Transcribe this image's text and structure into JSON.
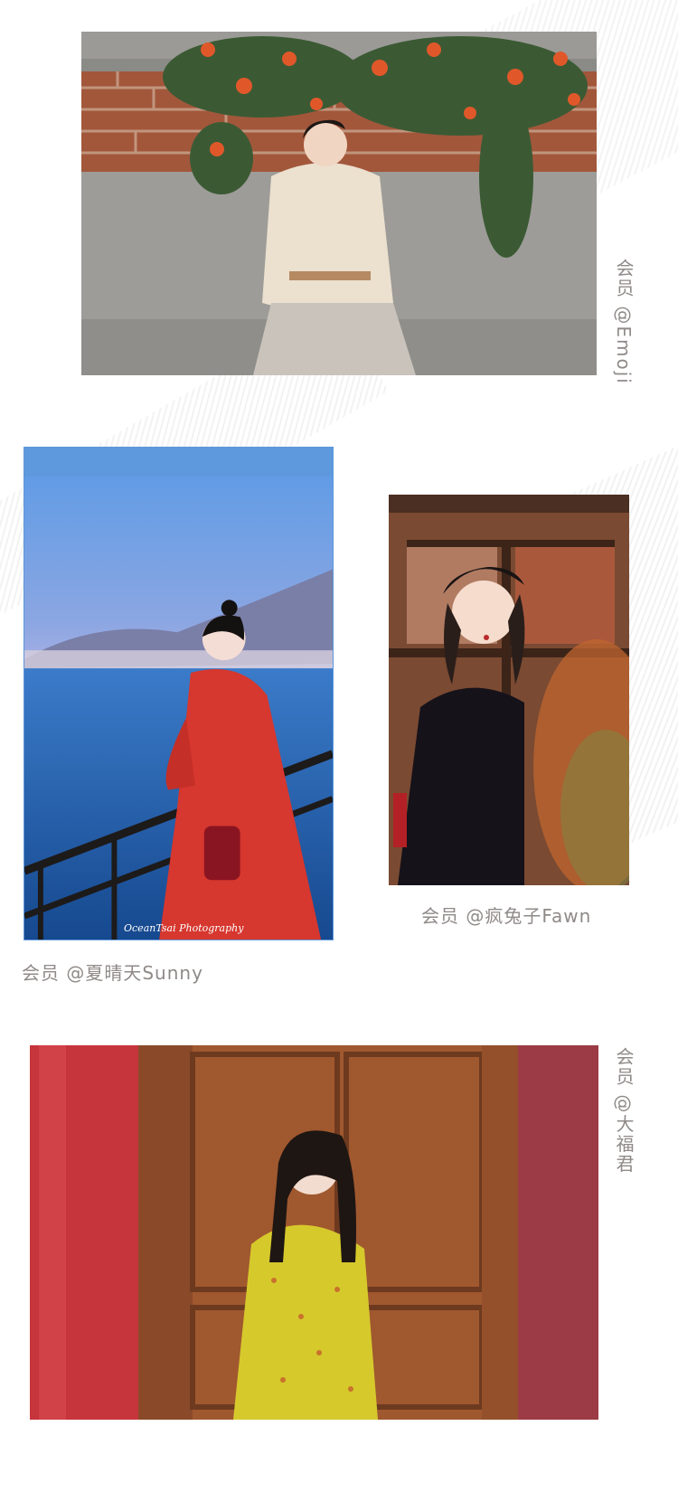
{
  "background_color": "#ffffff",
  "caption_color": "#8f8a88",
  "photos": [
    {
      "name": "photo-member-emoji",
      "description_icon": "photo-woman-cream-sweater-brick-wall-flowers",
      "caption": "会员 @Emoji",
      "caption_orientation": "vertical"
    },
    {
      "name": "photo-member-sunny",
      "description_icon": "photo-woman-red-coat-seaside",
      "caption": "会员 @夏晴天Sunny",
      "watermark": "OceanTsai Photography",
      "caption_orientation": "horizontal"
    },
    {
      "name": "photo-member-fawn",
      "description_icon": "photo-woman-black-dress-beret-window",
      "caption": "会员 @疯兔子Fawn",
      "caption_orientation": "horizontal"
    },
    {
      "name": "photo-member-dafujun",
      "description_icon": "photo-woman-yellow-dress-wooden-door",
      "caption": "会员 @大福君",
      "caption_orientation": "vertical"
    }
  ]
}
